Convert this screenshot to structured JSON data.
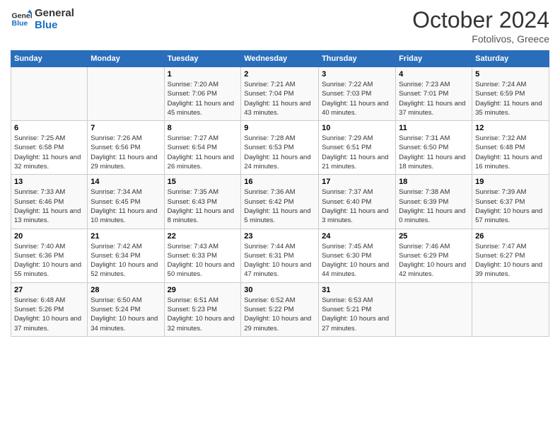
{
  "header": {
    "logo_line1": "General",
    "logo_line2": "Blue",
    "month": "October 2024",
    "location": "Fotolivos, Greece"
  },
  "columns": [
    "Sunday",
    "Monday",
    "Tuesday",
    "Wednesday",
    "Thursday",
    "Friday",
    "Saturday"
  ],
  "weeks": [
    [
      {
        "day": "",
        "sunrise": "",
        "sunset": "",
        "daylight": ""
      },
      {
        "day": "",
        "sunrise": "",
        "sunset": "",
        "daylight": ""
      },
      {
        "day": "1",
        "sunrise": "Sunrise: 7:20 AM",
        "sunset": "Sunset: 7:06 PM",
        "daylight": "Daylight: 11 hours and 45 minutes."
      },
      {
        "day": "2",
        "sunrise": "Sunrise: 7:21 AM",
        "sunset": "Sunset: 7:04 PM",
        "daylight": "Daylight: 11 hours and 43 minutes."
      },
      {
        "day": "3",
        "sunrise": "Sunrise: 7:22 AM",
        "sunset": "Sunset: 7:03 PM",
        "daylight": "Daylight: 11 hours and 40 minutes."
      },
      {
        "day": "4",
        "sunrise": "Sunrise: 7:23 AM",
        "sunset": "Sunset: 7:01 PM",
        "daylight": "Daylight: 11 hours and 37 minutes."
      },
      {
        "day": "5",
        "sunrise": "Sunrise: 7:24 AM",
        "sunset": "Sunset: 6:59 PM",
        "daylight": "Daylight: 11 hours and 35 minutes."
      }
    ],
    [
      {
        "day": "6",
        "sunrise": "Sunrise: 7:25 AM",
        "sunset": "Sunset: 6:58 PM",
        "daylight": "Daylight: 11 hours and 32 minutes."
      },
      {
        "day": "7",
        "sunrise": "Sunrise: 7:26 AM",
        "sunset": "Sunset: 6:56 PM",
        "daylight": "Daylight: 11 hours and 29 minutes."
      },
      {
        "day": "8",
        "sunrise": "Sunrise: 7:27 AM",
        "sunset": "Sunset: 6:54 PM",
        "daylight": "Daylight: 11 hours and 26 minutes."
      },
      {
        "day": "9",
        "sunrise": "Sunrise: 7:28 AM",
        "sunset": "Sunset: 6:53 PM",
        "daylight": "Daylight: 11 hours and 24 minutes."
      },
      {
        "day": "10",
        "sunrise": "Sunrise: 7:29 AM",
        "sunset": "Sunset: 6:51 PM",
        "daylight": "Daylight: 11 hours and 21 minutes."
      },
      {
        "day": "11",
        "sunrise": "Sunrise: 7:31 AM",
        "sunset": "Sunset: 6:50 PM",
        "daylight": "Daylight: 11 hours and 18 minutes."
      },
      {
        "day": "12",
        "sunrise": "Sunrise: 7:32 AM",
        "sunset": "Sunset: 6:48 PM",
        "daylight": "Daylight: 11 hours and 16 minutes."
      }
    ],
    [
      {
        "day": "13",
        "sunrise": "Sunrise: 7:33 AM",
        "sunset": "Sunset: 6:46 PM",
        "daylight": "Daylight: 11 hours and 13 minutes."
      },
      {
        "day": "14",
        "sunrise": "Sunrise: 7:34 AM",
        "sunset": "Sunset: 6:45 PM",
        "daylight": "Daylight: 11 hours and 10 minutes."
      },
      {
        "day": "15",
        "sunrise": "Sunrise: 7:35 AM",
        "sunset": "Sunset: 6:43 PM",
        "daylight": "Daylight: 11 hours and 8 minutes."
      },
      {
        "day": "16",
        "sunrise": "Sunrise: 7:36 AM",
        "sunset": "Sunset: 6:42 PM",
        "daylight": "Daylight: 11 hours and 5 minutes."
      },
      {
        "day": "17",
        "sunrise": "Sunrise: 7:37 AM",
        "sunset": "Sunset: 6:40 PM",
        "daylight": "Daylight: 11 hours and 3 minutes."
      },
      {
        "day": "18",
        "sunrise": "Sunrise: 7:38 AM",
        "sunset": "Sunset: 6:39 PM",
        "daylight": "Daylight: 11 hours and 0 minutes."
      },
      {
        "day": "19",
        "sunrise": "Sunrise: 7:39 AM",
        "sunset": "Sunset: 6:37 PM",
        "daylight": "Daylight: 10 hours and 57 minutes."
      }
    ],
    [
      {
        "day": "20",
        "sunrise": "Sunrise: 7:40 AM",
        "sunset": "Sunset: 6:36 PM",
        "daylight": "Daylight: 10 hours and 55 minutes."
      },
      {
        "day": "21",
        "sunrise": "Sunrise: 7:42 AM",
        "sunset": "Sunset: 6:34 PM",
        "daylight": "Daylight: 10 hours and 52 minutes."
      },
      {
        "day": "22",
        "sunrise": "Sunrise: 7:43 AM",
        "sunset": "Sunset: 6:33 PM",
        "daylight": "Daylight: 10 hours and 50 minutes."
      },
      {
        "day": "23",
        "sunrise": "Sunrise: 7:44 AM",
        "sunset": "Sunset: 6:31 PM",
        "daylight": "Daylight: 10 hours and 47 minutes."
      },
      {
        "day": "24",
        "sunrise": "Sunrise: 7:45 AM",
        "sunset": "Sunset: 6:30 PM",
        "daylight": "Daylight: 10 hours and 44 minutes."
      },
      {
        "day": "25",
        "sunrise": "Sunrise: 7:46 AM",
        "sunset": "Sunset: 6:29 PM",
        "daylight": "Daylight: 10 hours and 42 minutes."
      },
      {
        "day": "26",
        "sunrise": "Sunrise: 7:47 AM",
        "sunset": "Sunset: 6:27 PM",
        "daylight": "Daylight: 10 hours and 39 minutes."
      }
    ],
    [
      {
        "day": "27",
        "sunrise": "Sunrise: 6:48 AM",
        "sunset": "Sunset: 5:26 PM",
        "daylight": "Daylight: 10 hours and 37 minutes."
      },
      {
        "day": "28",
        "sunrise": "Sunrise: 6:50 AM",
        "sunset": "Sunset: 5:24 PM",
        "daylight": "Daylight: 10 hours and 34 minutes."
      },
      {
        "day": "29",
        "sunrise": "Sunrise: 6:51 AM",
        "sunset": "Sunset: 5:23 PM",
        "daylight": "Daylight: 10 hours and 32 minutes."
      },
      {
        "day": "30",
        "sunrise": "Sunrise: 6:52 AM",
        "sunset": "Sunset: 5:22 PM",
        "daylight": "Daylight: 10 hours and 29 minutes."
      },
      {
        "day": "31",
        "sunrise": "Sunrise: 6:53 AM",
        "sunset": "Sunset: 5:21 PM",
        "daylight": "Daylight: 10 hours and 27 minutes."
      },
      {
        "day": "",
        "sunrise": "",
        "sunset": "",
        "daylight": ""
      },
      {
        "day": "",
        "sunrise": "",
        "sunset": "",
        "daylight": ""
      }
    ]
  ]
}
